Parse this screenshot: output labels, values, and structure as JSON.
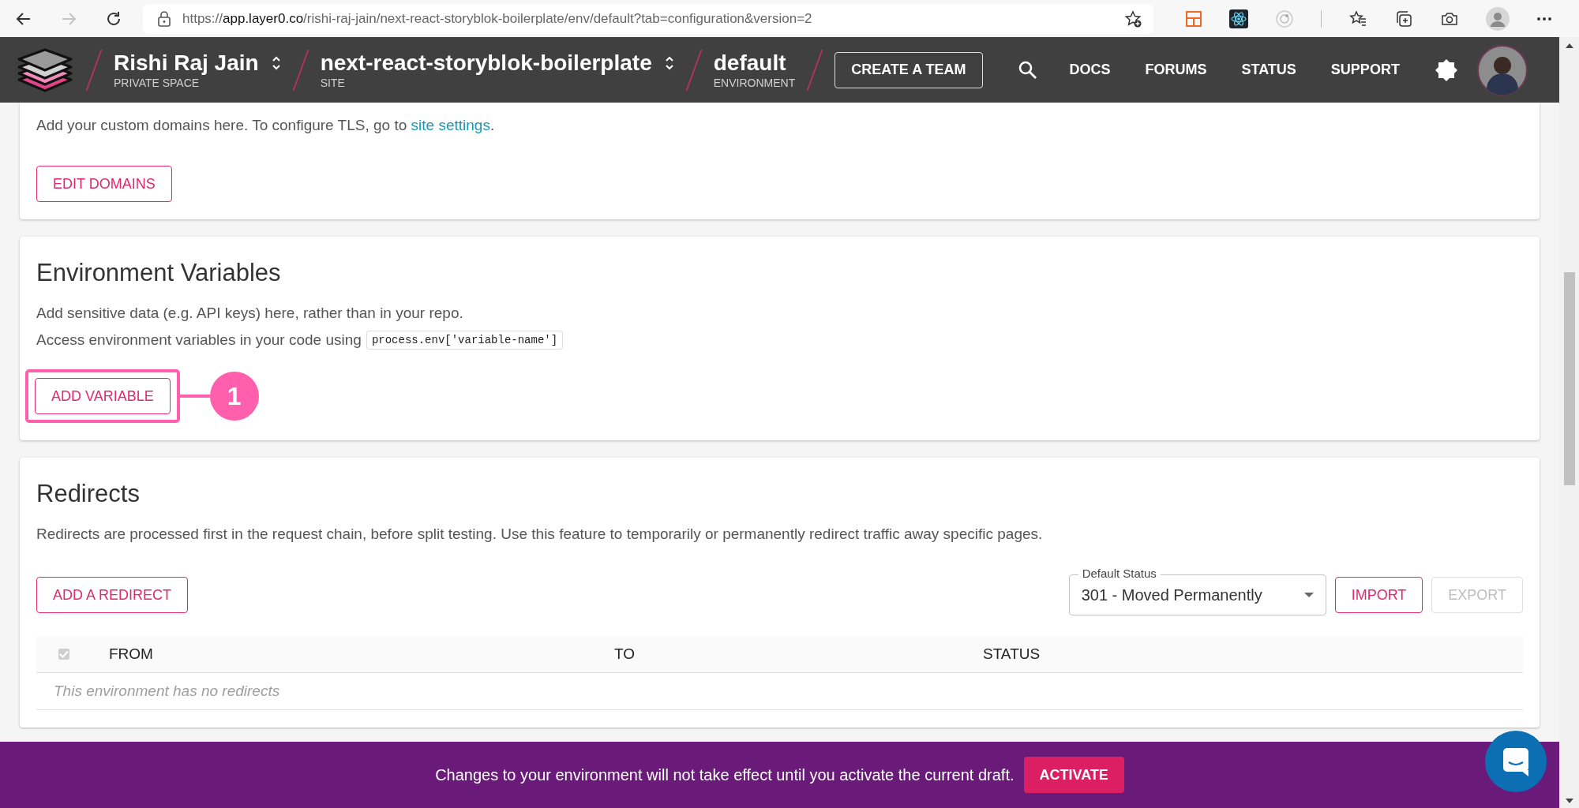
{
  "browser": {
    "url": {
      "scheme": "https://",
      "host": "app.layer0.co",
      "path": "/rishi-raj-jain/next-react-storyblok-boilerplate/env/default?tab=configuration&version=2"
    },
    "nav_buttons": [
      {
        "kind": "back",
        "disabled": false
      },
      {
        "kind": "forward",
        "disabled": true
      },
      {
        "kind": "reload",
        "disabled": false
      }
    ]
  },
  "header": {
    "crumbs": [
      {
        "title": "Rishi Raj Jain",
        "subtitle": "PRIVATE SPACE",
        "switcher": true
      },
      {
        "title": "next-react-storyblok-boilerplate",
        "subtitle": "SITE",
        "switcher": true
      },
      {
        "title": "default",
        "subtitle": "ENVIRONMENT",
        "switcher": false
      }
    ],
    "create_team": "CREATE A TEAM",
    "links": [
      "DOCS",
      "FORUMS",
      "STATUS",
      "SUPPORT"
    ]
  },
  "domains": {
    "text_before": "Add your custom domains here. To configure TLS, go to ",
    "link": "site settings",
    "text_after": ".",
    "button": "EDIT DOMAINS"
  },
  "env_vars": {
    "title": "Environment Variables",
    "lines": [
      "Add sensitive data (e.g. API keys) here, rather than in your repo.",
      "Access environment variables in your code using "
    ],
    "code": "process.env['variable-name']",
    "button": "ADD VARIABLE",
    "callout": "1"
  },
  "redirects": {
    "title": "Redirects",
    "text": "Redirects are processed first in the request chain, before split testing. Use this feature to temporarily or permanently redirect traffic away specific pages.",
    "add_button": "ADD A REDIRECT",
    "default_status": {
      "label": "Default Status",
      "value": "301 - Moved Permanently"
    },
    "actions": [
      {
        "label": "IMPORT",
        "disabled": false
      },
      {
        "label": "EXPORT",
        "disabled": true
      }
    ],
    "table": {
      "select_all": {
        "checked": true,
        "disabled": true
      },
      "columns": [
        "FROM",
        "TO",
        "STATUS"
      ],
      "empty_text": "This environment has no redirects"
    }
  },
  "banner": {
    "text": "Changes to your environment will not take effect until you activate the current draft.",
    "button": "ACTIVATE"
  }
}
